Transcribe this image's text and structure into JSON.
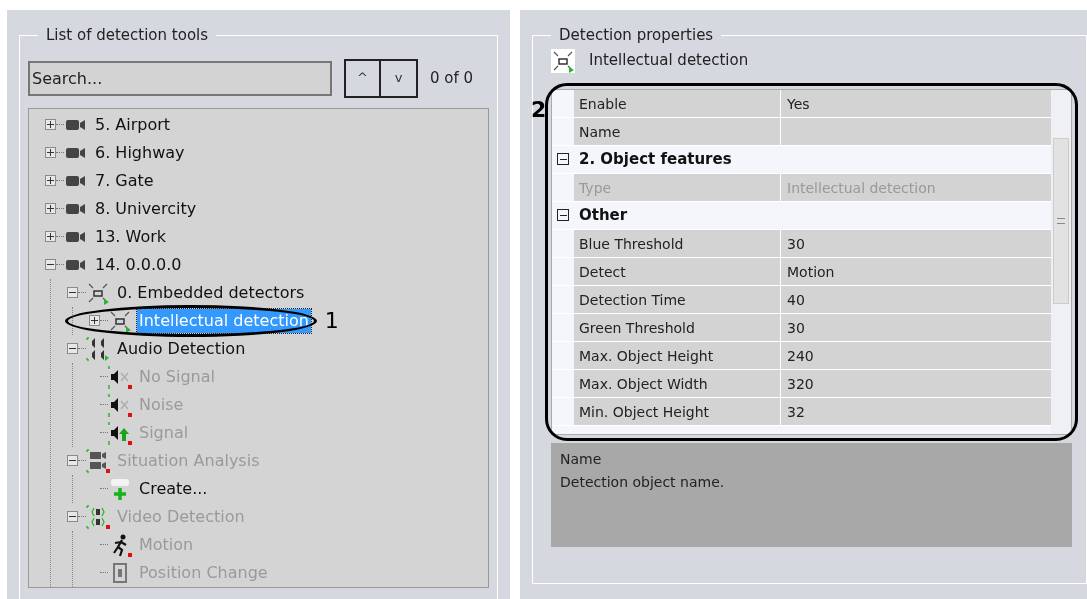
{
  "left_panel": {
    "title": "List of detection tools",
    "search": {
      "placeholder": "Search...",
      "match_count": "0 of 0",
      "buttons": [
        "^",
        "v"
      ]
    },
    "tree": [
      {
        "label": "5. Airport",
        "kind": "camera",
        "expanded": false,
        "disabled": false,
        "selected": false
      },
      {
        "label": "6. Highway",
        "kind": "camera",
        "expanded": false,
        "disabled": false,
        "selected": false
      },
      {
        "label": "7. Gate",
        "kind": "camera",
        "expanded": false,
        "disabled": false,
        "selected": false
      },
      {
        "label": "8. Univercity",
        "kind": "camera",
        "expanded": false,
        "disabled": false,
        "selected": false
      },
      {
        "label": "13. Work",
        "kind": "camera",
        "expanded": false,
        "disabled": false,
        "selected": false
      },
      {
        "label": "14. 0.0.0.0",
        "kind": "camera",
        "expanded": true,
        "disabled": false,
        "selected": false,
        "children": [
          {
            "label": "0. Embedded detectors",
            "kind": "detector",
            "expanded": true,
            "disabled": false,
            "selected": false,
            "children": [
              {
                "label": "Intellectual detection",
                "kind": "detector",
                "expanded": false,
                "disabled": false,
                "selected": true,
                "callout": "1"
              }
            ]
          },
          {
            "label": "Audio Detection",
            "kind": "audio",
            "expanded": true,
            "disabled": false,
            "selected": false,
            "children": [
              {
                "label": "No Signal",
                "kind": "speaker",
                "disabled": true,
                "selected": false
              },
              {
                "label": "Noise",
                "kind": "speaker",
                "disabled": true,
                "selected": false
              },
              {
                "label": "Signal",
                "kind": "speaker-up",
                "disabled": true,
                "selected": false
              }
            ]
          },
          {
            "label": "Situation Analysis",
            "kind": "situation",
            "expanded": true,
            "disabled": true,
            "selected": false,
            "children": [
              {
                "label": "Create...",
                "kind": "create",
                "disabled": false,
                "selected": false
              }
            ]
          },
          {
            "label": "Video Detection",
            "kind": "video",
            "expanded": true,
            "disabled": true,
            "selected": false,
            "children": [
              {
                "label": "Motion",
                "kind": "motion",
                "disabled": true,
                "selected": false
              },
              {
                "label": "Position Change",
                "kind": "position",
                "disabled": true,
                "selected": false
              }
            ]
          }
        ]
      }
    ]
  },
  "right_panel": {
    "title": "Detection properties",
    "header": "Intellectual detection",
    "grid": {
      "callout": "2",
      "rows": [
        {
          "kind": "property",
          "label": "Enable",
          "value": "Yes",
          "disabled": false
        },
        {
          "kind": "property",
          "label": "Name",
          "disabled": false
        },
        {
          "kind": "group",
          "label": "2. Object features",
          "expanded": true
        },
        {
          "kind": "property",
          "label": "Type",
          "value": "Intellectual detection",
          "disabled": true
        },
        {
          "kind": "group",
          "label": "Other",
          "expanded": true
        },
        {
          "kind": "property",
          "label": "Blue Threshold",
          "value": "30",
          "disabled": false
        },
        {
          "kind": "property",
          "label": "Detect",
          "value": "Motion",
          "disabled": false
        },
        {
          "kind": "property",
          "label": "Detection Time",
          "value": "40",
          "disabled": false
        },
        {
          "kind": "property",
          "label": "Green Threshold",
          "value": "30",
          "disabled": false
        },
        {
          "kind": "property",
          "label": "Max. Object Height",
          "value": "240",
          "disabled": false
        },
        {
          "kind": "property",
          "label": "Max. Object Width",
          "value": "320",
          "disabled": false
        },
        {
          "kind": "property",
          "label": "Min. Object Height",
          "value": "32",
          "disabled": false
        }
      ]
    },
    "description": {
      "title": "Name",
      "text": "Detection object name."
    }
  }
}
